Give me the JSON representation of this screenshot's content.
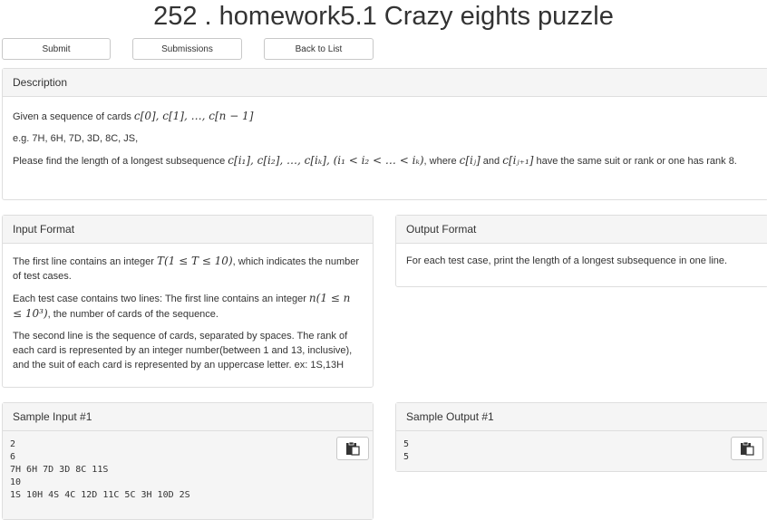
{
  "page": {
    "title": "252 . homework5.1 Crazy eights puzzle"
  },
  "buttons": {
    "submit": "Submit",
    "submissions": "Submissions",
    "back": "Back to List"
  },
  "description": {
    "header": "Description",
    "line1_text": "Given a sequence of cards ",
    "line1_math": "c[0], c[1], …, c[n − 1]",
    "line2": "e.g. 7H, 6H, 7D, 3D, 8C, JS,",
    "line3_a": "Please find the length of a longest subsequence ",
    "line3_math1": "c[i₁], c[i₂], …, c[iₖ], (i₁ < i₂ < … < iₖ)",
    "line3_b": ", where ",
    "line3_math2": "c[iⱼ]",
    "line3_c": " and ",
    "line3_math3": "c[iⱼ₊₁]",
    "line3_d": " have the same suit or rank or one has rank 8."
  },
  "input_format": {
    "header": "Input Format",
    "p1_a": "The first line contains an integer ",
    "p1_math": "T(1 ≤ T ≤ 10)",
    "p1_b": ", which indicates the number of test cases.",
    "p2_a": "Each test case contains two lines: The first line contains an integer ",
    "p2_math": "n(1 ≤ n ≤ 10³)",
    "p2_b": ", the number of cards of the sequence.",
    "p3": "The second line is the sequence of cards, separated by spaces. The rank of each card is represented by an integer number(between 1 and 13, inclusive), and the suit of each card is represented by an uppercase letter. ex: 1S,13H"
  },
  "output_format": {
    "header": "Output Format",
    "p1": "For each test case, print the length of a longest subsequence in one line."
  },
  "sample_input": {
    "header": "Sample Input #1",
    "content": "2\n6\n7H 6H 7D 3D 8C 11S\n10\n1S 10H 4S 4C 12D 11C 5C 3H 10D 2S"
  },
  "sample_output": {
    "header": "Sample Output #1",
    "content": "5\n5"
  },
  "icons": {
    "copy": "clipboard-paste-icon"
  }
}
